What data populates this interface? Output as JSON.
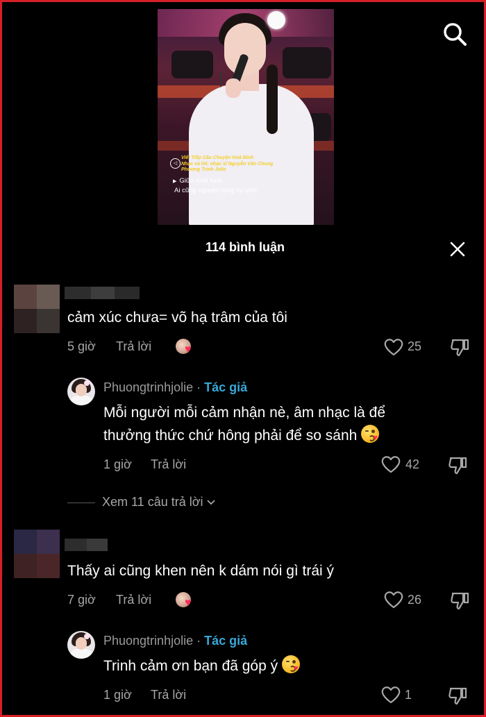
{
  "video": {
    "credit_line1": "Viết Tiếp Câu Chuyện Hoà Bình",
    "credit_line2": "Nhạc và lời: nhạc sĩ Nguyễn Văn Chung",
    "credit_line3": "Phương Trinh Jolie",
    "lyric_line1": "Giữa khói binh",
    "lyric_line2": "Ai cũng nguyện lòng hy sinh"
  },
  "icons": {
    "search": "search-icon",
    "close": "close-icon",
    "like": "heart-icon",
    "dislike": "thumbs-down-icon"
  },
  "header": {
    "title": "114 bình luận"
  },
  "reply_label": "Trả lời",
  "author": {
    "name": "Phuongtrinhjolie",
    "separator": "·",
    "tag": "Tác giả"
  },
  "comments": [
    {
      "text": "cảm xúc chưa= võ hạ trâm của tôi",
      "time": "5 giờ",
      "likes": "25",
      "reply": {
        "line1": "Mỗi người mỗi cảm nhận nè, âm nhạc là để",
        "line2": "thưởng thức chứ hông phải để so sánh",
        "time": "1 giờ",
        "likes": "42"
      },
      "view_more": "Xem 11 câu trả lời"
    },
    {
      "text": "Thấy ai cũng khen nên k dám nói gì trái ý",
      "time": "7 giờ",
      "likes": "26",
      "reply": {
        "line1": "Trinh cảm ơn bạn đã góp ý",
        "time": "1 giờ",
        "likes": "1"
      }
    }
  ],
  "colors": {
    "background": "#000000",
    "border": "#d61f26",
    "author_tag": "#38a8d8",
    "heart": "#ff2a55",
    "muted": "#a8a8a8"
  }
}
